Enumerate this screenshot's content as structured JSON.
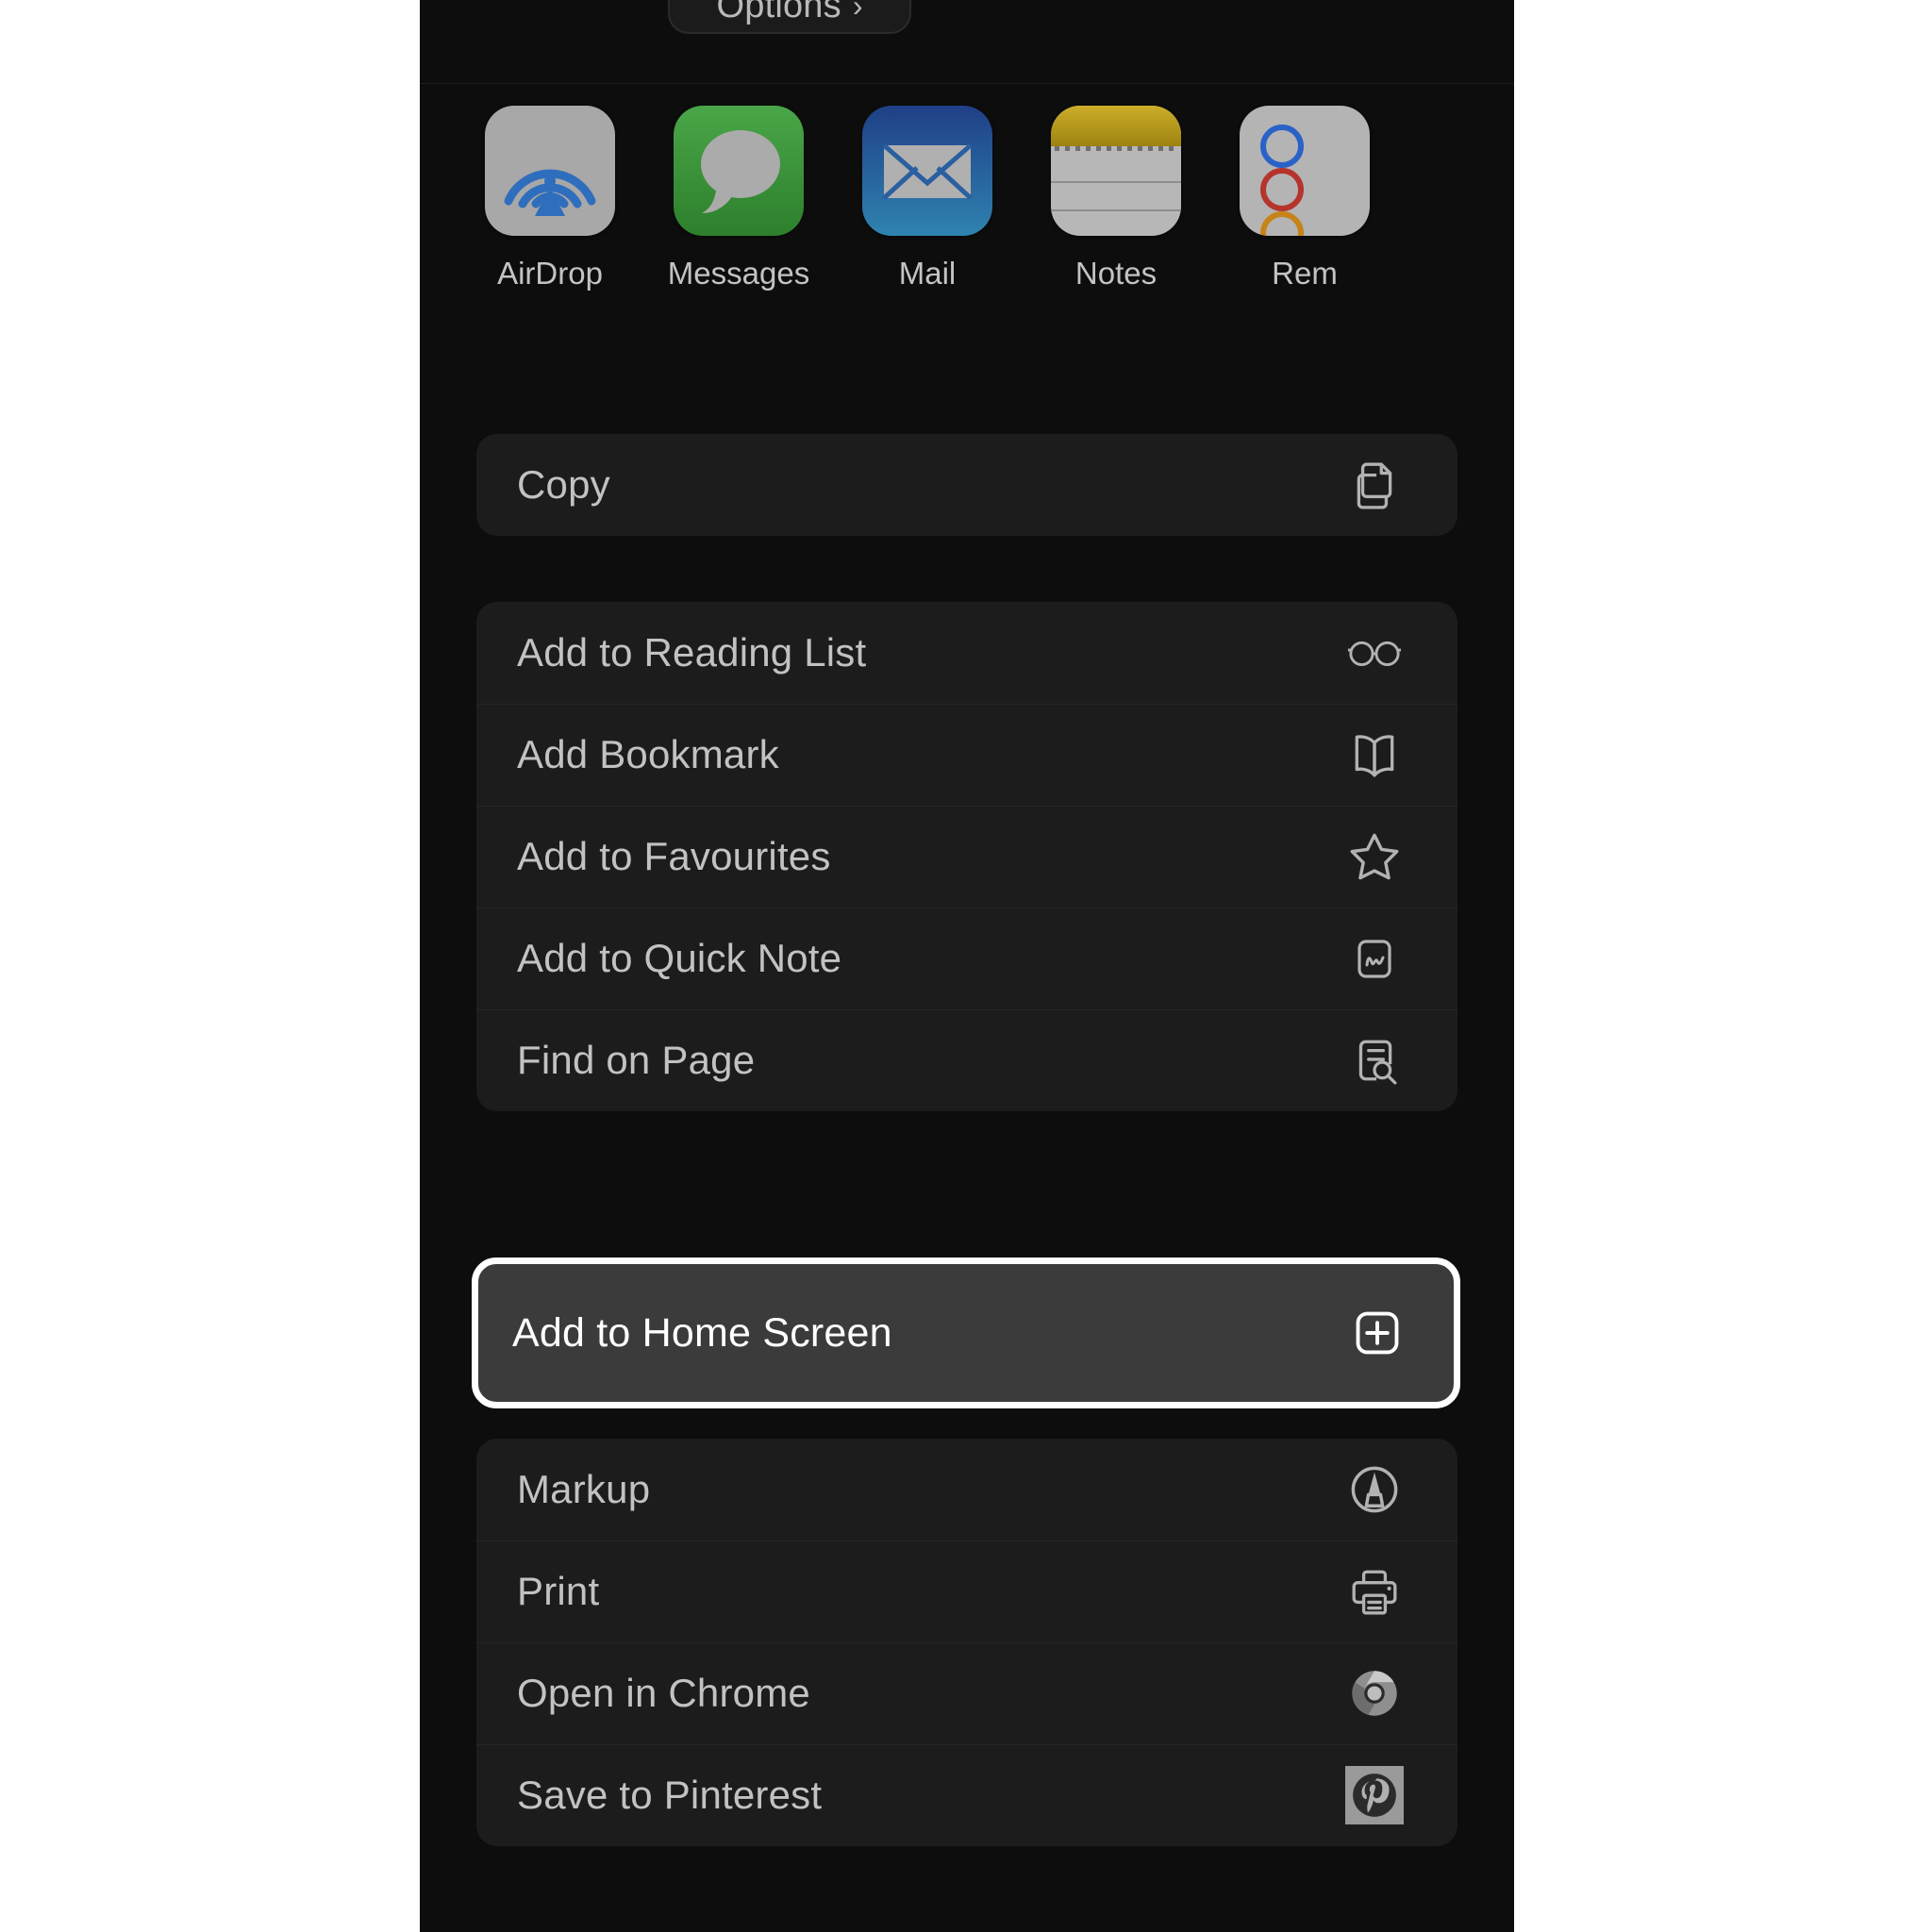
{
  "sheet": {
    "options_button": {
      "label": "Options",
      "chevron": "›"
    },
    "apps": [
      {
        "label": "AirDrop",
        "icon": "airdrop-icon"
      },
      {
        "label": "Messages",
        "icon": "messages-icon"
      },
      {
        "label": "Mail",
        "icon": "mail-icon"
      },
      {
        "label": "Notes",
        "icon": "notes-icon"
      },
      {
        "label": "Rem",
        "icon": "reminders-icon"
      }
    ],
    "groups": [
      {
        "name": "copy-group",
        "rows": [
          {
            "label": "Copy",
            "icon": "copy-icon"
          }
        ]
      },
      {
        "name": "actions-group",
        "rows": [
          {
            "label": "Add to Reading List",
            "icon": "glasses-icon"
          },
          {
            "label": "Add Bookmark",
            "icon": "book-icon"
          },
          {
            "label": "Add to Favourites",
            "icon": "star-icon"
          },
          {
            "label": "Add to Quick Note",
            "icon": "quick-note-icon"
          },
          {
            "label": "Find on Page",
            "icon": "document-search-icon"
          }
        ]
      },
      {
        "name": "highlighted-group",
        "rows": [
          {
            "label": "Add to Home Screen",
            "icon": "plus-square-icon"
          }
        ]
      },
      {
        "name": "tools-group",
        "rows": [
          {
            "label": "Markup",
            "icon": "markup-icon"
          },
          {
            "label": "Print",
            "icon": "printer-icon"
          },
          {
            "label": "Open in Chrome",
            "icon": "chrome-icon"
          },
          {
            "label": "Save to Pinterest",
            "icon": "pinterest-icon"
          }
        ]
      }
    ]
  },
  "colors": {
    "sheet_background": "#0d0d0d",
    "card_background": "#1c1c1c",
    "highlight_background": "#3b3b3b",
    "highlight_border": "#ffffff",
    "label_text": "#c2c2c2",
    "highlight_text": "#ffffff",
    "messages_green": "#3d9339",
    "mail_blue": "#2a5fa0",
    "notes_yellow": "#b59a1e",
    "airdrop_blue": "#2f6ebd",
    "reminder_blue": "#2b62c8",
    "reminder_red": "#b5352c",
    "reminder_orange": "#c68318"
  }
}
